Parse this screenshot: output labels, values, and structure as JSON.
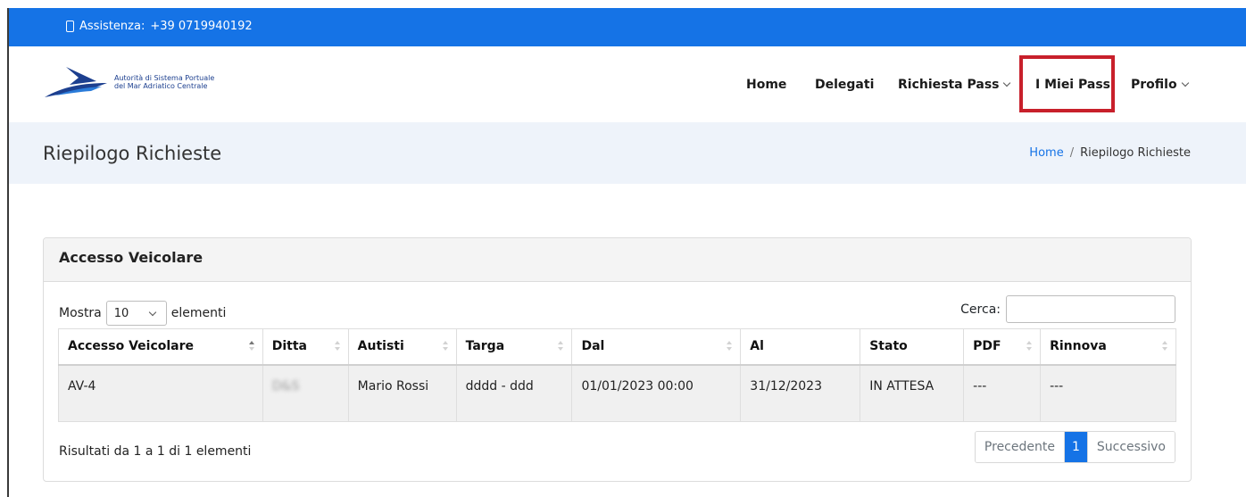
{
  "topbar": {
    "assist_label": "Assistenza:",
    "assist_phone": "+39 0719940192"
  },
  "logo": {
    "line1": "Autorità di Sistema Portuale",
    "line2": "del Mar Adriatico Centrale"
  },
  "nav": {
    "home": "Home",
    "delegati": "Delegati",
    "richiesta_pass": "Richiesta Pass",
    "miei_pass": "I Miei Pass",
    "profilo": "Profilo"
  },
  "page": {
    "title": "Riepilogo Richieste"
  },
  "breadcrumb": {
    "home": "Home",
    "sep": "/",
    "current": "Riepilogo Richieste"
  },
  "card": {
    "title": "Accesso Veicolare"
  },
  "table_controls": {
    "show_label": "Mostra",
    "page_size": "10",
    "elements_label": "elementi",
    "search_label": "Cerca:"
  },
  "table": {
    "columns": [
      "Accesso Veicolare",
      "Ditta",
      "Autisti",
      "Targa",
      "Dal",
      "Al",
      "Stato",
      "PDF",
      "Rinnova"
    ],
    "rows": [
      {
        "accesso": "AV-4",
        "ditta": "D&S",
        "autisti": "Mario Rossi",
        "targa": "dddd - ddd",
        "dal": "01/01/2023 00:00",
        "al": "31/12/2023",
        "stato": "IN ATTESA",
        "pdf": "---",
        "rinnova": "---"
      }
    ]
  },
  "footer": {
    "info": "Risultati da 1 a 1 di 1 elementi"
  },
  "pager": {
    "prev": "Precedente",
    "current": "1",
    "next": "Successivo"
  },
  "colors": {
    "primary": "#1573e6",
    "highlight": "#c8202b",
    "title_bg": "#eef3fa"
  },
  "icons": {
    "phone": "phone-icon",
    "logo": "ship-logo-icon",
    "dropdown": "chevron-down-icon",
    "sort": "sort-icon"
  }
}
